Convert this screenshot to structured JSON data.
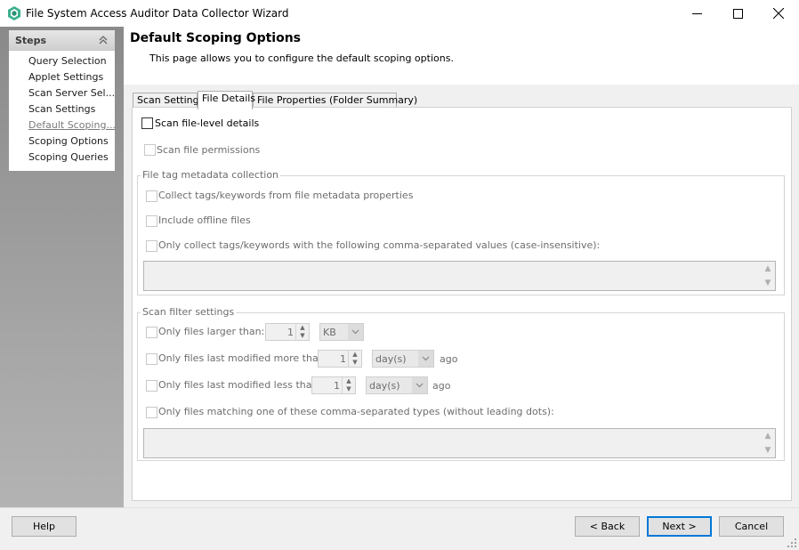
{
  "window": {
    "title": "File System Access Auditor Data Collector Wizard",
    "app_icon": "app-logo-icon",
    "minimize_icon": "minimize-icon",
    "maximize_icon": "maximize-icon",
    "close_icon": "close-icon"
  },
  "sidebar": {
    "title": "Steps",
    "collapse_icon": "double-chevron-up-icon",
    "items": [
      {
        "label": "Query Selection",
        "current": false
      },
      {
        "label": "Applet Settings",
        "current": false
      },
      {
        "label": "Scan Server Sel...",
        "current": false
      },
      {
        "label": "Scan Settings",
        "current": false
      },
      {
        "label": "Default Scoping...",
        "current": true
      },
      {
        "label": "Scoping Options",
        "current": false
      },
      {
        "label": "Scoping Queries",
        "current": false
      }
    ]
  },
  "header": {
    "title": "Default Scoping Options",
    "description": "This page allows you to configure the default scoping options."
  },
  "tabs": [
    {
      "label": "Scan Settings",
      "active": false
    },
    {
      "label": "File Details",
      "active": true
    },
    {
      "label": "File Properties (Folder Summary)",
      "active": false
    }
  ],
  "file_details": {
    "scan_file_level": {
      "label": "Scan file-level details",
      "checked": false,
      "enabled": true
    },
    "scan_permissions": {
      "label": "Scan file permissions",
      "checked": false,
      "enabled": false
    },
    "metadata_group": {
      "title": "File tag metadata collection",
      "collect_tags": {
        "label": "Collect tags/keywords from file metadata properties",
        "checked": false
      },
      "include_offline": {
        "label": "Include offline files",
        "checked": false
      },
      "only_collect": {
        "label": "Only collect tags/keywords with the following comma-separated values (case-insensitive):",
        "checked": false
      },
      "values_text": ""
    },
    "filter_group": {
      "title": "Scan filter settings",
      "larger_than": {
        "label": "Only files larger than:",
        "value": "1",
        "unit": "KB",
        "checked": false
      },
      "modified_more": {
        "label": "Only files last modified more than:",
        "value": "1",
        "unit": "day(s)",
        "suffix": "ago",
        "checked": false
      },
      "modified_less": {
        "label": "Only files last modified less than:",
        "value": "1",
        "unit": "day(s)",
        "suffix": "ago",
        "checked": false
      },
      "matching_types": {
        "label": "Only files matching one of these comma-separated types (without leading dots):",
        "checked": false
      },
      "types_text": ""
    }
  },
  "footer": {
    "help": "Help",
    "back": "< Back",
    "next": "Next >",
    "cancel": "Cancel"
  },
  "colors": {
    "accent": "#0078d7",
    "sidebar_gradient_top": "#8a8a8a",
    "disabled_text": "#6d6d6d"
  }
}
